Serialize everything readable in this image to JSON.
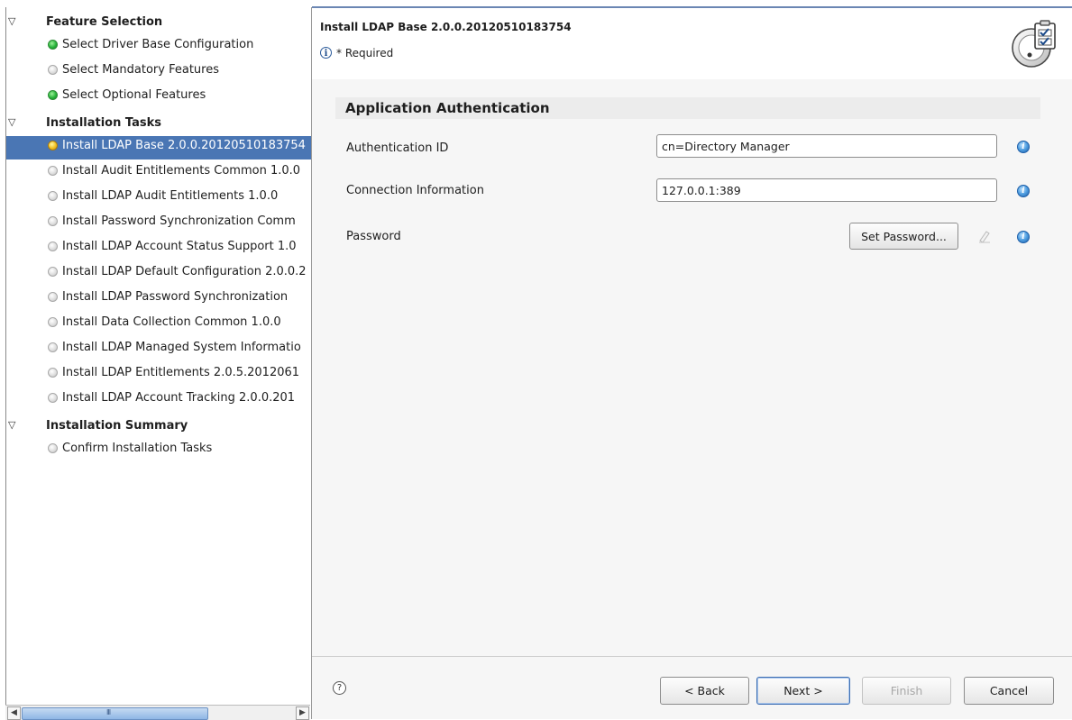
{
  "tree": {
    "groups": [
      {
        "label": "Feature Selection",
        "items": [
          {
            "label": "Select Driver Base Configuration",
            "status": "done"
          },
          {
            "label": "Select Mandatory Features",
            "status": "todo"
          },
          {
            "label": "Select Optional Features",
            "status": "done"
          }
        ]
      },
      {
        "label": "Installation Tasks",
        "items": [
          {
            "label": "Install LDAP Base 2.0.0.20120510183754",
            "status": "current",
            "selected": true
          },
          {
            "label": "Install Audit Entitlements Common 1.0.0",
            "status": "todo"
          },
          {
            "label": "Install LDAP Audit Entitlements 1.0.0",
            "status": "todo"
          },
          {
            "label": "Install Password Synchronization Comm",
            "status": "todo"
          },
          {
            "label": "Install LDAP Account Status Support 1.0",
            "status": "todo"
          },
          {
            "label": "Install LDAP Default Configuration 2.0.0.2",
            "status": "todo"
          },
          {
            "label": "Install LDAP Password Synchronization",
            "status": "todo"
          },
          {
            "label": "Install Data Collection Common 1.0.0",
            "status": "todo"
          },
          {
            "label": "Install LDAP Managed System Informatio",
            "status": "todo"
          },
          {
            "label": "Install LDAP Entitlements 2.0.5.2012061",
            "status": "todo"
          },
          {
            "label": "Install LDAP Account Tracking 2.0.0.201",
            "status": "todo"
          }
        ]
      },
      {
        "label": "Installation Summary",
        "items": [
          {
            "label": "Confirm Installation Tasks",
            "status": "todo"
          }
        ]
      }
    ],
    "scrollbar_grip": "III"
  },
  "header": {
    "title": "Install LDAP Base 2.0.0.20120510183754",
    "required_note": "* Required",
    "info_glyph": "i"
  },
  "content": {
    "section_title": "Application Authentication",
    "authentication_id": {
      "label": "Authentication ID",
      "value": "cn=Directory Manager"
    },
    "connection_information": {
      "label": "Connection Information",
      "value": "127.0.0.1:389"
    },
    "password": {
      "label": "Password",
      "button_label": "Set Password..."
    }
  },
  "footer": {
    "help_glyph": "?",
    "back_label": "< Back",
    "next_label": "Next >",
    "finish_label": "Finish",
    "cancel_label": "Cancel"
  },
  "colors": {
    "selection": "#4a76b4",
    "status_done": "#27b43a",
    "status_current": "#f0c020",
    "status_todo": "#dcdcdc",
    "help_icon": "#4e9de0"
  }
}
